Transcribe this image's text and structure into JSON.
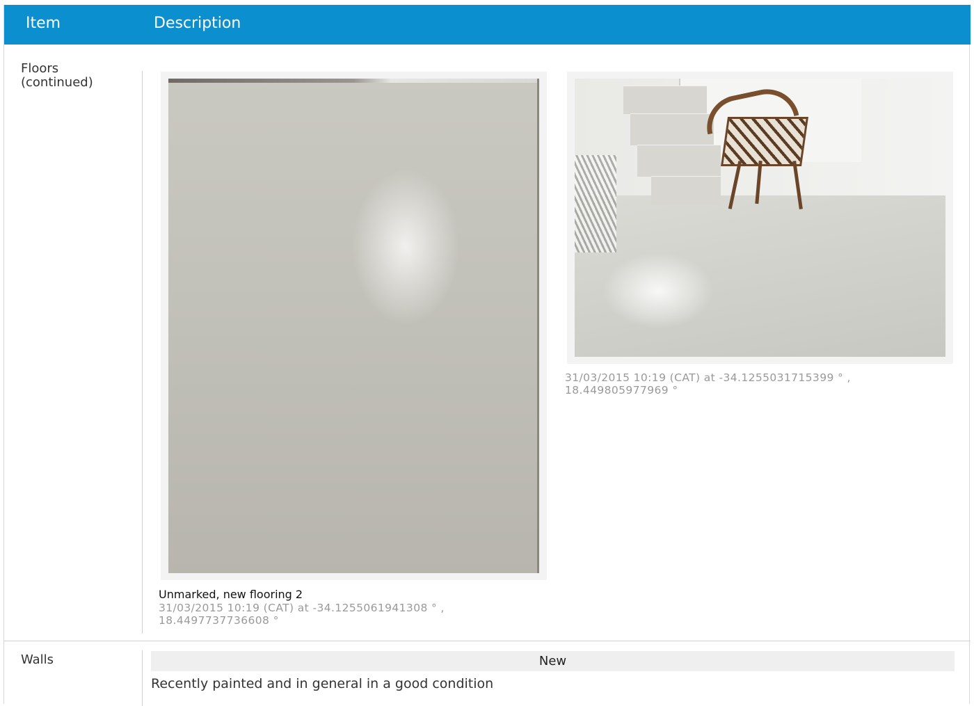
{
  "header": {
    "item": "Item",
    "description": "Description"
  },
  "rows": [
    {
      "item": "Floors (continued)",
      "item_lines": [
        "Floors",
        "(continued)"
      ],
      "photos": [
        {
          "title": "Unmarked, new flooring 2",
          "caption_lines": [
            "31/03/2015 10:19 (CAT) at -34.1255061941308 ° ,",
            "18.4497737736608 °"
          ]
        },
        {
          "title": "",
          "caption_lines": [
            "31/03/2015 10:19 (CAT) at -34.1255031715399 ° ,",
            "18.449805977969 °"
          ]
        }
      ]
    },
    {
      "item": "Walls",
      "condition": "New",
      "description": "Recently painted and in general in a good condition"
    }
  ]
}
